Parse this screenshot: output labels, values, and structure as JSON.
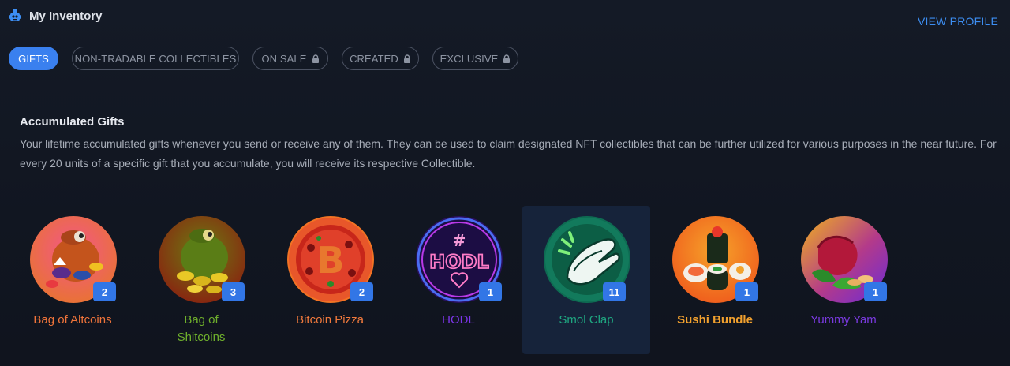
{
  "header": {
    "title": "My Inventory",
    "view_profile": "VIEW PROFILE",
    "icon": "robot-icon"
  },
  "tabs": [
    {
      "label": "GIFTS",
      "active": true,
      "locked": false
    },
    {
      "label": "NON-TRADABLE COLLECTIBLES",
      "active": false,
      "locked": false
    },
    {
      "label": "ON SALE",
      "active": false,
      "locked": true
    },
    {
      "label": "CREATED",
      "active": false,
      "locked": true
    },
    {
      "label": "EXCLUSIVE",
      "active": false,
      "locked": true
    }
  ],
  "section": {
    "title": "Accumulated Gifts",
    "description": "Your lifetime accumulated gifts whenever you send or receive any of them. They can be used to claim designated NFT collectibles that can be further utilized for various purposes in the near future. For every 20 units of a specific gift that you accumulate, you will receive its respective Collectible."
  },
  "gifts": [
    {
      "name": "Bag of Altcoins",
      "count": "2",
      "color": "#f0743a",
      "icon": "altcoin-bag-icon",
      "selected": false
    },
    {
      "name": "Bag of Shitcoins",
      "count": "3",
      "color": "#6fb02c",
      "icon": "shitcoin-bag-icon",
      "selected": false
    },
    {
      "name": "Bitcoin Pizza",
      "count": "2",
      "color": "#f0793c",
      "icon": "bitcoin-pizza-icon",
      "selected": false
    },
    {
      "name": "HODL",
      "count": "1",
      "color": "#7b35e8",
      "icon": "hodl-neon-icon",
      "selected": false
    },
    {
      "name": "Smol Clap",
      "count": "11",
      "color": "#1fa781",
      "icon": "clapping-hands-icon",
      "selected": true
    },
    {
      "name": "Sushi Bundle",
      "count": "1",
      "color": "#f2a12e",
      "icon": "sushi-icon",
      "selected": false
    },
    {
      "name": "Yummy Yam",
      "count": "1",
      "color": "#7a3ae0",
      "icon": "yam-icon",
      "selected": false
    }
  ]
}
